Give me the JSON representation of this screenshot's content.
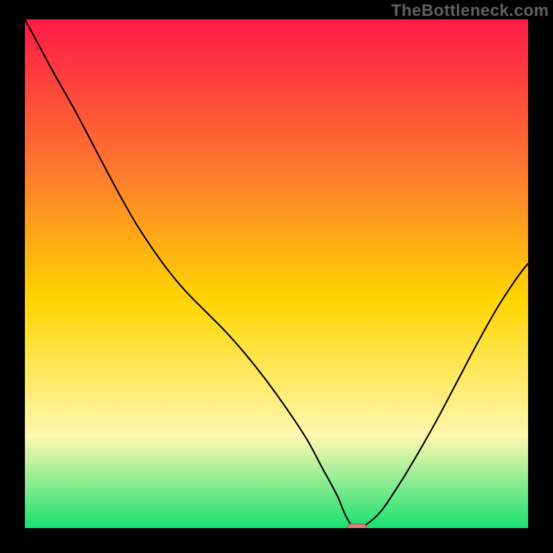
{
  "watermark": "TheBottleneck.com",
  "colors": {
    "frame": "#000000",
    "watermark": "#606060",
    "curve": "#000000",
    "marker_fill": "#d97e84",
    "marker_stroke": "#b85a62",
    "gradient_top": "#ff1a47",
    "gradient_mid_upper": "#ff7a2e",
    "gradient_mid": "#ffd500",
    "gradient_pale": "#fff8b0",
    "gradient_bottom": "#18e070"
  },
  "chart_data": {
    "type": "line",
    "title": "",
    "xlabel": "",
    "ylabel": "",
    "xlim": [
      0,
      100
    ],
    "ylim": [
      0,
      100
    ],
    "x": [
      0,
      3,
      6,
      10,
      14,
      18,
      22,
      26,
      29,
      32,
      36,
      40,
      44,
      48,
      52,
      56,
      59,
      62,
      64,
      66,
      70,
      74,
      78,
      82,
      86,
      90,
      94,
      98,
      100
    ],
    "values": [
      100.0,
      94.5,
      89.0,
      82.0,
      74.5,
      67.0,
      60.0,
      54.0,
      50.0,
      46.5,
      42.5,
      38.5,
      34.0,
      29.0,
      23.5,
      17.5,
      12.0,
      6.5,
      2.0,
      0.0,
      2.5,
      8.0,
      14.5,
      21.5,
      29.0,
      36.5,
      43.5,
      49.5,
      52.0
    ],
    "marker": {
      "x": 66,
      "y": 0,
      "shape": "rounded-rect"
    }
  }
}
